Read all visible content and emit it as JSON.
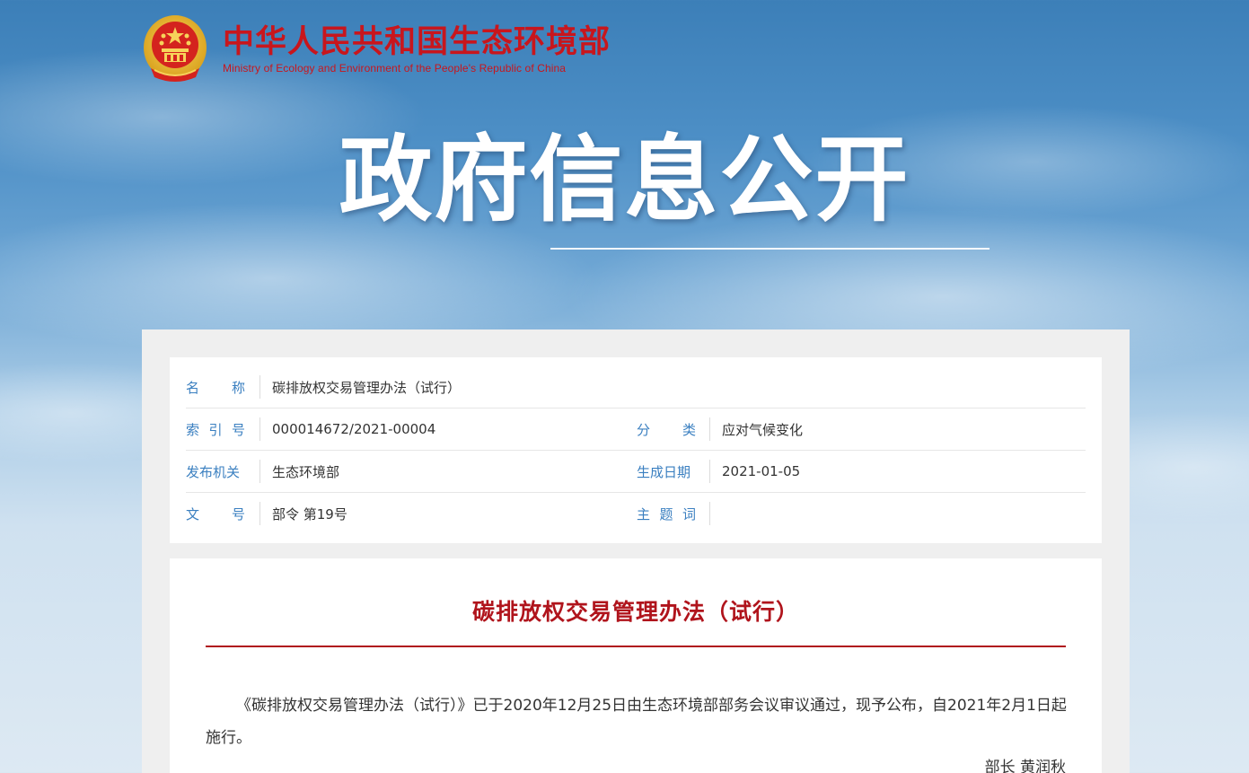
{
  "site": {
    "name_cn": "中华人民共和国生态环境部",
    "name_en": "Ministry of Ecology and Environment of the People's Republic of China",
    "emblem_icon": "national-emblem-icon"
  },
  "hero": {
    "title": "政府信息公开"
  },
  "info": {
    "name_label": [
      "名",
      "称"
    ],
    "name_value": "碳排放权交易管理办法（试行）",
    "index_label": [
      "索",
      "引",
      "号"
    ],
    "index_value": "000014672/2021-00004",
    "category_label": [
      "分",
      "类"
    ],
    "category_value": "应对气候变化",
    "issuer_label": [
      "发布机关"
    ],
    "issuer_value": "生态环境部",
    "date_label": [
      "生成日期"
    ],
    "date_value": "2021-01-05",
    "doc_label": [
      "文",
      "号"
    ],
    "doc_value": "部令 第19号",
    "keywords_label": [
      "主",
      "题",
      "词"
    ],
    "keywords_value": ""
  },
  "article": {
    "title": "碳排放权交易管理办法（试行）",
    "body": "《碳排放权交易管理办法（试行）》已于2020年12月25日由生态环境部部务会议审议通过，现予公布，自2021年2月1日起施行。",
    "signature": "部长 黄润秋"
  },
  "colors": {
    "brand_red": "#c8161d",
    "label_blue": "#3a7fc0",
    "title_red": "#b0141c"
  }
}
